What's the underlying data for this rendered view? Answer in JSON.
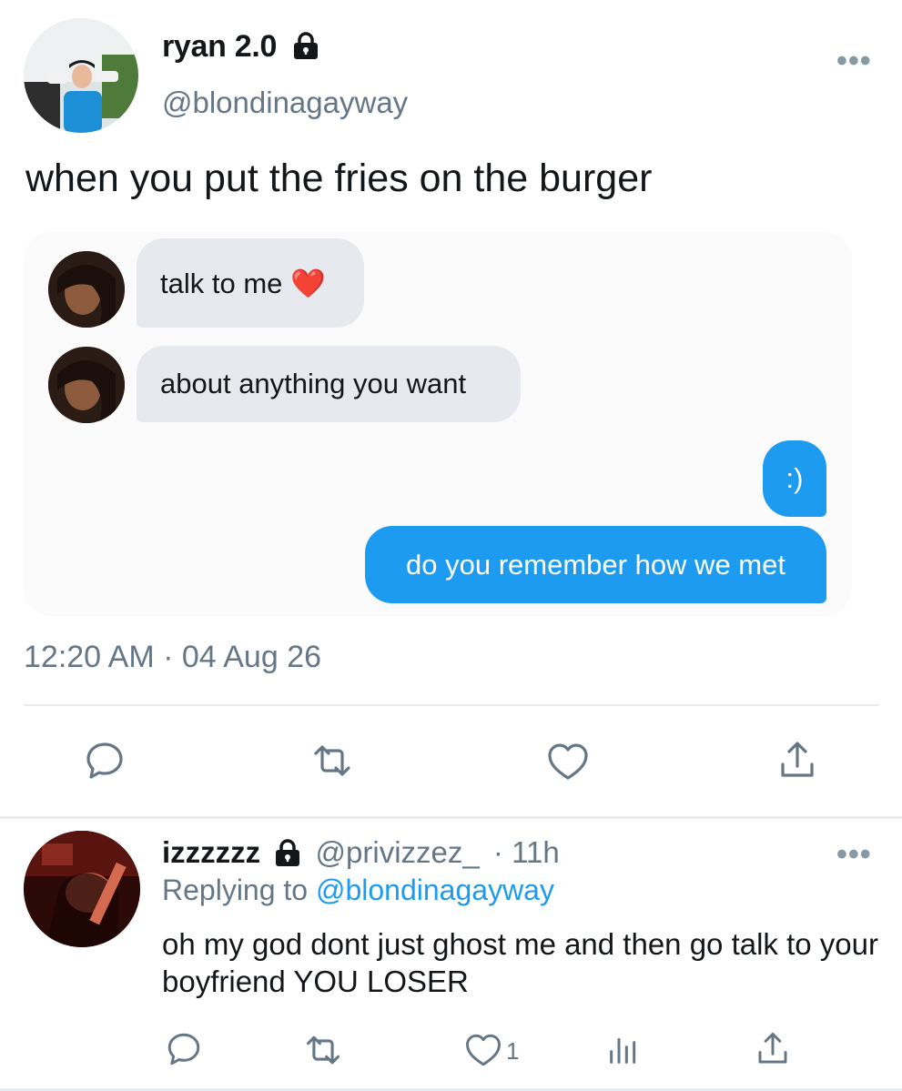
{
  "tweet": {
    "author_name": "ryan 2.0",
    "author_handle": "@blondinagayway",
    "text": "when you put the fries on the burger",
    "timestamp": "12:20 AM · 04 Aug 26",
    "more_label": "•••"
  },
  "chat": {
    "messages": [
      {
        "direction": "incoming",
        "text": "talk to me ❤️"
      },
      {
        "direction": "incoming",
        "text": "about anything you want"
      },
      {
        "direction": "outgoing",
        "text": ":)"
      },
      {
        "direction": "outgoing",
        "text": "do you remember how we met"
      }
    ]
  },
  "actions": {
    "icons": [
      "reply-icon",
      "retweet-icon",
      "like-icon",
      "share-icon"
    ]
  },
  "reply": {
    "author_name": "izzzzzz",
    "author_handle": "@privizzez_",
    "time": "· 11h",
    "replying_prefix": "Replying to",
    "replying_handle": "@blondinagayway",
    "text": "oh my god dont just ghost me and then go talk to your boyfriend YOU LOSER",
    "like_count": "1",
    "more_label": "•••",
    "icons": [
      "reply-icon",
      "retweet-icon",
      "like-icon",
      "analytics-icon",
      "share-icon"
    ]
  },
  "colors": {
    "accent_blue": "#1d9bf0",
    "secondary_text": "#657786",
    "incoming_bubble": "#e6e9ed"
  }
}
